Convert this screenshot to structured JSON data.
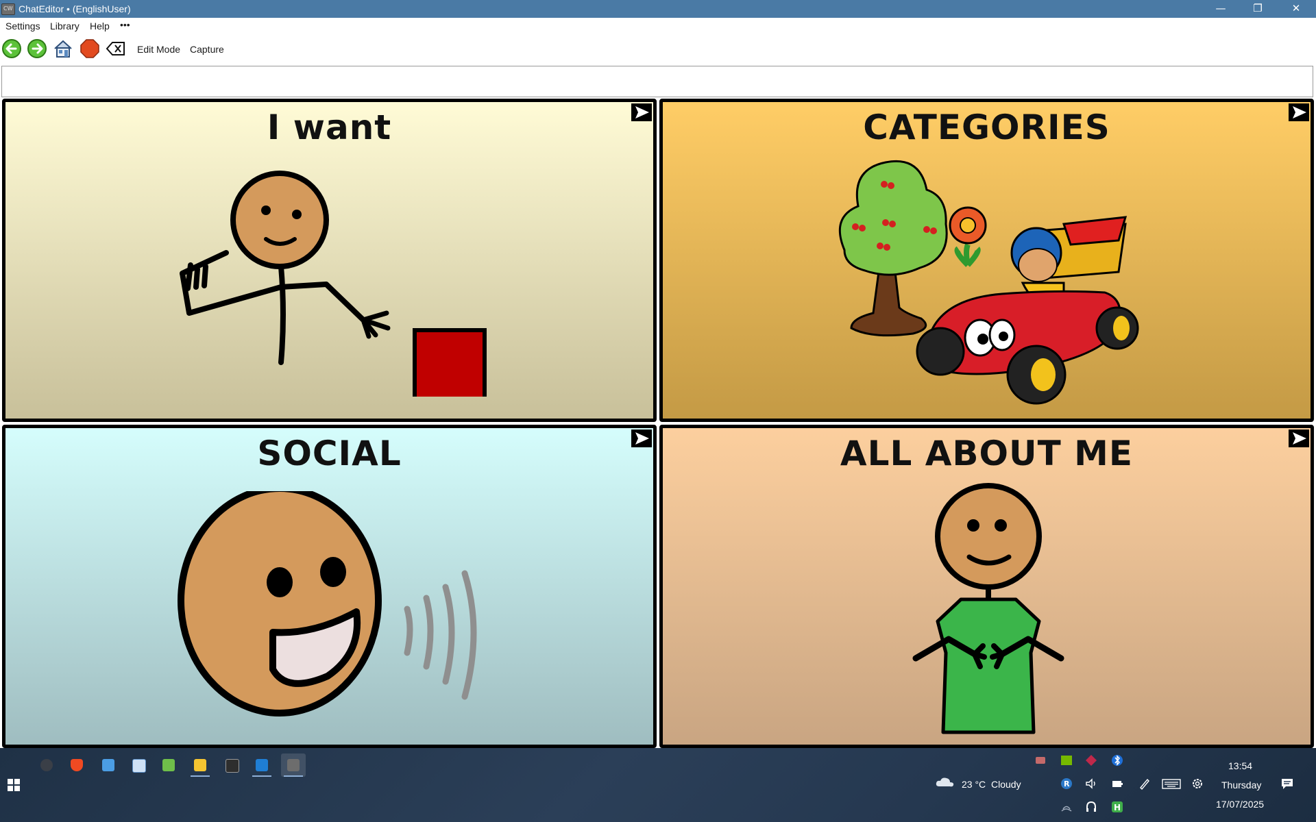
{
  "window": {
    "title": "ChatEditor • (EnglishUser)",
    "minimize_glyph": "—",
    "maximize_glyph": "❐",
    "close_glyph": "✕"
  },
  "menu": {
    "items": [
      "Settings",
      "Library",
      "Help"
    ],
    "more_glyph": "•••"
  },
  "toolbar": {
    "edit_mode_label": "Edit Mode",
    "capture_label": "Capture",
    "icons": [
      "back-arrow-icon",
      "forward-arrow-icon",
      "home-icon",
      "stop-icon",
      "clear-icon"
    ]
  },
  "message_bar": {
    "value": ""
  },
  "grid": {
    "cells": [
      {
        "label": "I want",
        "color_top": "#fffbd6",
        "color_bottom": "#c8c09a",
        "picture": "person-pointing-red-square"
      },
      {
        "label": "CATEGORIES",
        "color_top": "#ffcd66",
        "color_bottom": "#c49a45",
        "picture": "tree-flower-race-car"
      },
      {
        "label": "SOCIAL",
        "color_top": "#d5fdfc",
        "color_bottom": "#9fbdc0",
        "picture": "smiling-face-speaking"
      },
      {
        "label": "ALL ABOUT ME",
        "color_top": "#fccf9e",
        "color_bottom": "#c9a582",
        "picture": "person-pointing-self"
      }
    ],
    "jump_icon": "arrow-jump-icon"
  },
  "taskbar": {
    "start_icon": "windows-start-icon",
    "apps": [
      "system-app-icon",
      "brave-browser-icon",
      "remote-desktop-icon",
      "image-viewer-icon",
      "notepad-icon",
      "file-explorer-icon",
      "terminal-icon",
      "vscode-icon",
      "chateditor-icon"
    ],
    "weather": {
      "temp": "23 °C",
      "condition": "Cloudy"
    },
    "clock": {
      "time": "13:54",
      "day": "Thursday",
      "date": "17/07/2025"
    }
  }
}
